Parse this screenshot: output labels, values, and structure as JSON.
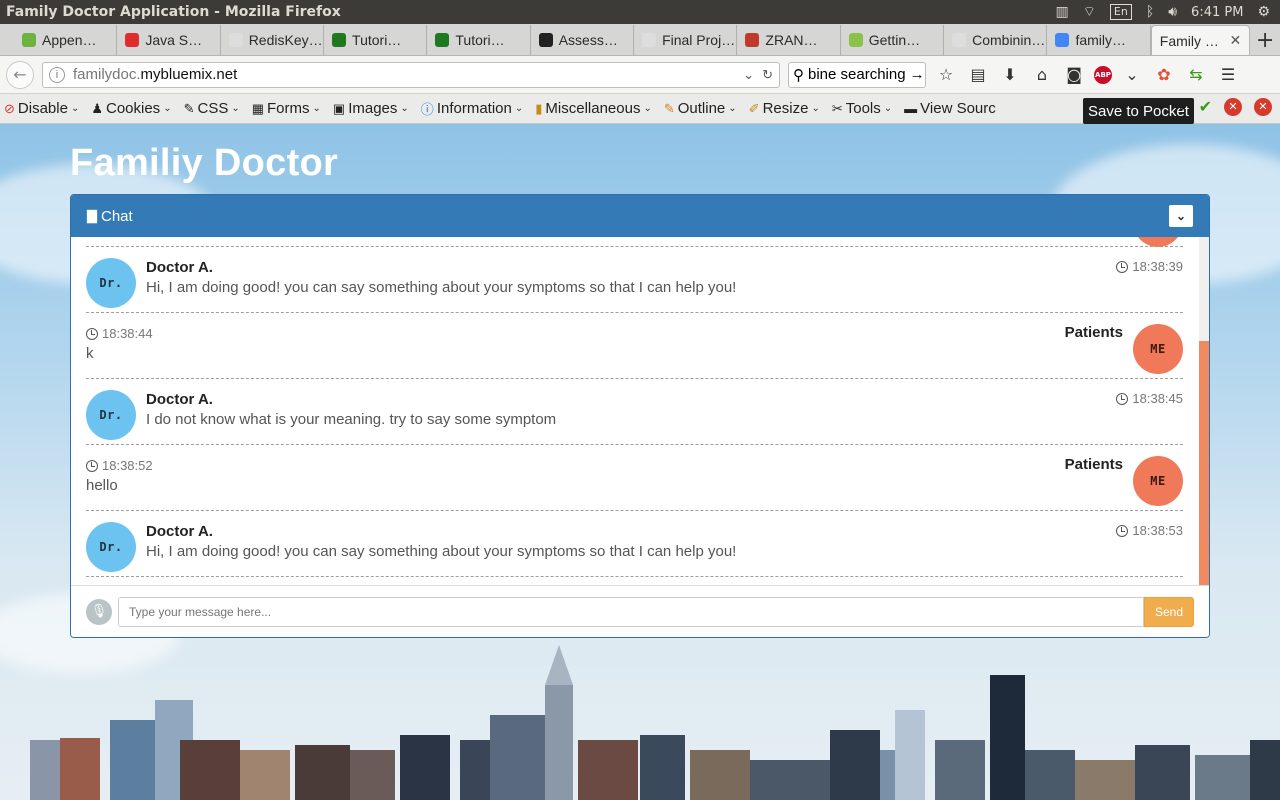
{
  "window": {
    "title": "Family Doctor Application - Mozilla Firefox"
  },
  "tray": {
    "lang": "En",
    "time": "6:41 PM"
  },
  "tabs": [
    {
      "label": "Appen…",
      "color": "#6db33f"
    },
    {
      "label": "Java S…",
      "color": "#e02c2c"
    },
    {
      "label": "RedisKey…",
      "color": "#dddddd"
    },
    {
      "label": "Tutori…",
      "color": "#1f7a1f"
    },
    {
      "label": "Tutori…",
      "color": "#1f7a1f"
    },
    {
      "label": "Assess…",
      "color": "#222222"
    },
    {
      "label": "Final Proj…",
      "color": "#dddddd"
    },
    {
      "label": "ZRAN…",
      "color": "#c0392b"
    },
    {
      "label": "Gettin…",
      "color": "#8bc34a"
    },
    {
      "label": "Combinin…",
      "color": "#dddddd"
    },
    {
      "label": "family…",
      "color": "#4285f4"
    }
  ],
  "active_tab": {
    "label": "Family …"
  },
  "address": {
    "url_prefix": "familydoc.",
    "url_domain": "mybluemix.net",
    "search_value": "bine searching"
  },
  "devtoolbar": {
    "items": [
      "Disable",
      "Cookies",
      "CSS",
      "Forms",
      "Images",
      "Information",
      "Miscellaneous",
      "Outline",
      "Resize",
      "Tools",
      "View Sourc"
    ],
    "tooltip": "Save to Pocket"
  },
  "page": {
    "title": "Familiy Doctor",
    "chat": {
      "header": "Chat",
      "messages": [
        {
          "role": "doctor",
          "avatar": "Dr.",
          "name": "Doctor A.",
          "time": "18:38:39",
          "text": "Hi, I am doing good! you can say something about your symptoms so that I can help you!"
        },
        {
          "role": "patient",
          "avatar": "ME",
          "name": "Patients",
          "time": "18:38:44",
          "text": "k"
        },
        {
          "role": "doctor",
          "avatar": "Dr.",
          "name": "Doctor A.",
          "time": "18:38:45",
          "text": "I do not know what is your meaning. try to say some symptom"
        },
        {
          "role": "patient",
          "avatar": "ME",
          "name": "Patients",
          "time": "18:38:52",
          "text": "hello"
        },
        {
          "role": "doctor",
          "avatar": "Dr.",
          "name": "Doctor A.",
          "time": "18:38:53",
          "text": "Hi, I am doing good! you can say something about your symptoms so that I can help you!"
        }
      ],
      "input_placeholder": "Type your message here...",
      "send_label": "Send"
    }
  },
  "colors": {
    "panel_header": "#337ab7",
    "doctor_avatar": "#6cc3ef",
    "patient_avatar": "#f0795a",
    "send_button": "#f0ad4e"
  }
}
